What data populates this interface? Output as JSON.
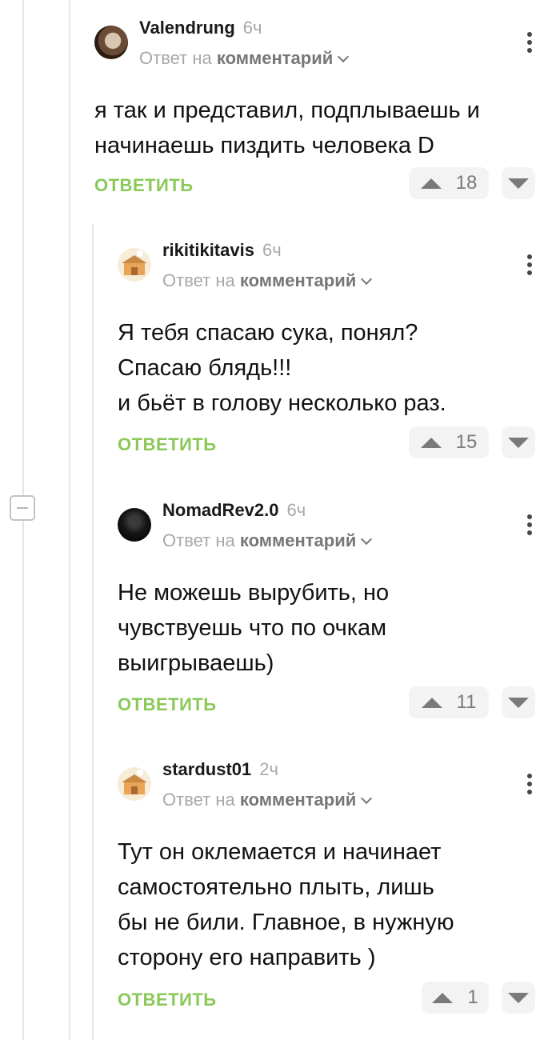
{
  "comments": [
    {
      "username": "Valendrung",
      "time": "6ч",
      "reply_prefix": "Ответ на",
      "reply_target": "комментарий",
      "text_lines": [
        "я так и представил, подплываешь и",
        "начинаешь пиздить человека D"
      ],
      "reply_label": "ОТВЕТИТЬ",
      "rating": "18",
      "avatar": "valendrung-avatar"
    },
    {
      "username": "rikitikitavis",
      "time": "6ч",
      "reply_prefix": "Ответ на",
      "reply_target": "комментарий",
      "text_lines": [
        "Я тебя спасаю сука, понял?",
        "Спасаю блядь!!!",
        "и бьёт в голову несколько раз."
      ],
      "reply_label": "ОТВЕТИТЬ",
      "rating": "15",
      "avatar": "default-house-avatar"
    },
    {
      "username": "NomadRev2.0",
      "time": "6ч",
      "reply_prefix": "Ответ на",
      "reply_target": "комментарий",
      "text_lines": [
        "Не можешь вырубить, но",
        "чувствуешь что по очкам",
        "выигрываешь)"
      ],
      "reply_label": "ОТВЕТИТЬ",
      "rating": "11",
      "avatar": "dark-avatar"
    },
    {
      "username": "stardust01",
      "time": "2ч",
      "reply_prefix": "Ответ на",
      "reply_target": "комментарий",
      "text_lines": [
        "Тут он оклемается и начинает",
        "самостоятельно плыть, лишь",
        "бы не били. Главное, в нужную",
        "сторону его направить )"
      ],
      "reply_label": "ОТВЕТИТЬ",
      "rating": "1",
      "avatar": "default-house-avatar"
    }
  ],
  "colors": {
    "accent": "#8ac858",
    "meta": "#a8a8a8",
    "rail": "#e6e6e6",
    "vote_bg": "#f3f3f3"
  },
  "icons": {
    "collapse": "minus-icon",
    "menu": "kebab-icon",
    "upvote": "triangle-up-icon",
    "downvote": "triangle-down-icon",
    "reply_dropdown": "chevron-down-icon"
  }
}
